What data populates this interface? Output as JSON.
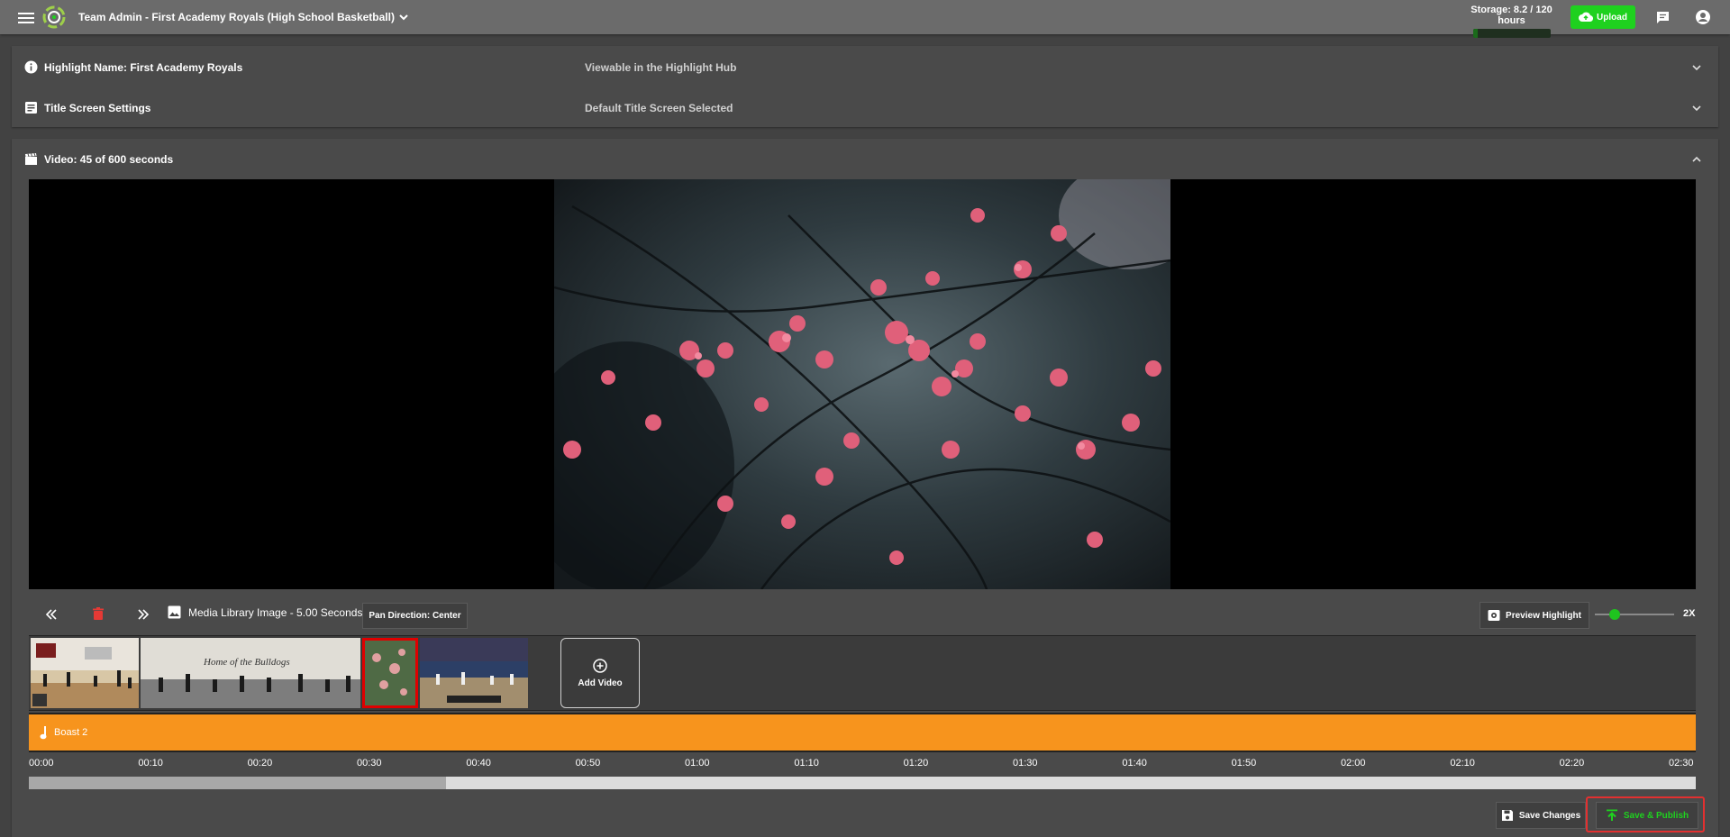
{
  "header": {
    "team_title": "Team Admin - First Academy Royals (High School Basketball)",
    "storage_label": "Storage: 8.2 / 120 hours",
    "storage_fraction": 0.068,
    "upload_label": "Upload"
  },
  "highlight": {
    "name_label": "Highlight Name: First Academy Royals",
    "visibility": "Viewable in the Highlight Hub"
  },
  "title_screen": {
    "label": "Title Screen Settings",
    "status": "Default Title Screen Selected"
  },
  "video": {
    "label": "Video: 45 of 600 seconds"
  },
  "controls": {
    "media_label": "Media Library Image - 5.00 Seconds",
    "pan_label": "Pan Direction: Center",
    "preview_label": "Preview Highlight",
    "speed_label": "2X",
    "speed_fraction": 0.25
  },
  "filmstrip": {
    "add_video_label": "Add Video"
  },
  "music": {
    "track_name": "Boast 2"
  },
  "timeline": {
    "ticks": [
      "00:00",
      "00:10",
      "00:20",
      "00:30",
      "00:40",
      "00:50",
      "01:00",
      "01:10",
      "01:20",
      "01:30",
      "01:40",
      "01:50",
      "02:00",
      "02:10",
      "02:20",
      "02:30"
    ],
    "progress_fraction": 0.25
  },
  "footer": {
    "save_label": "Save Changes",
    "publish_label": "Save & Publish"
  },
  "colors": {
    "accent_green": "#1fd11f",
    "music_orange": "#f7941d",
    "highlight_red": "#e23030",
    "delete_red": "#e53935"
  }
}
